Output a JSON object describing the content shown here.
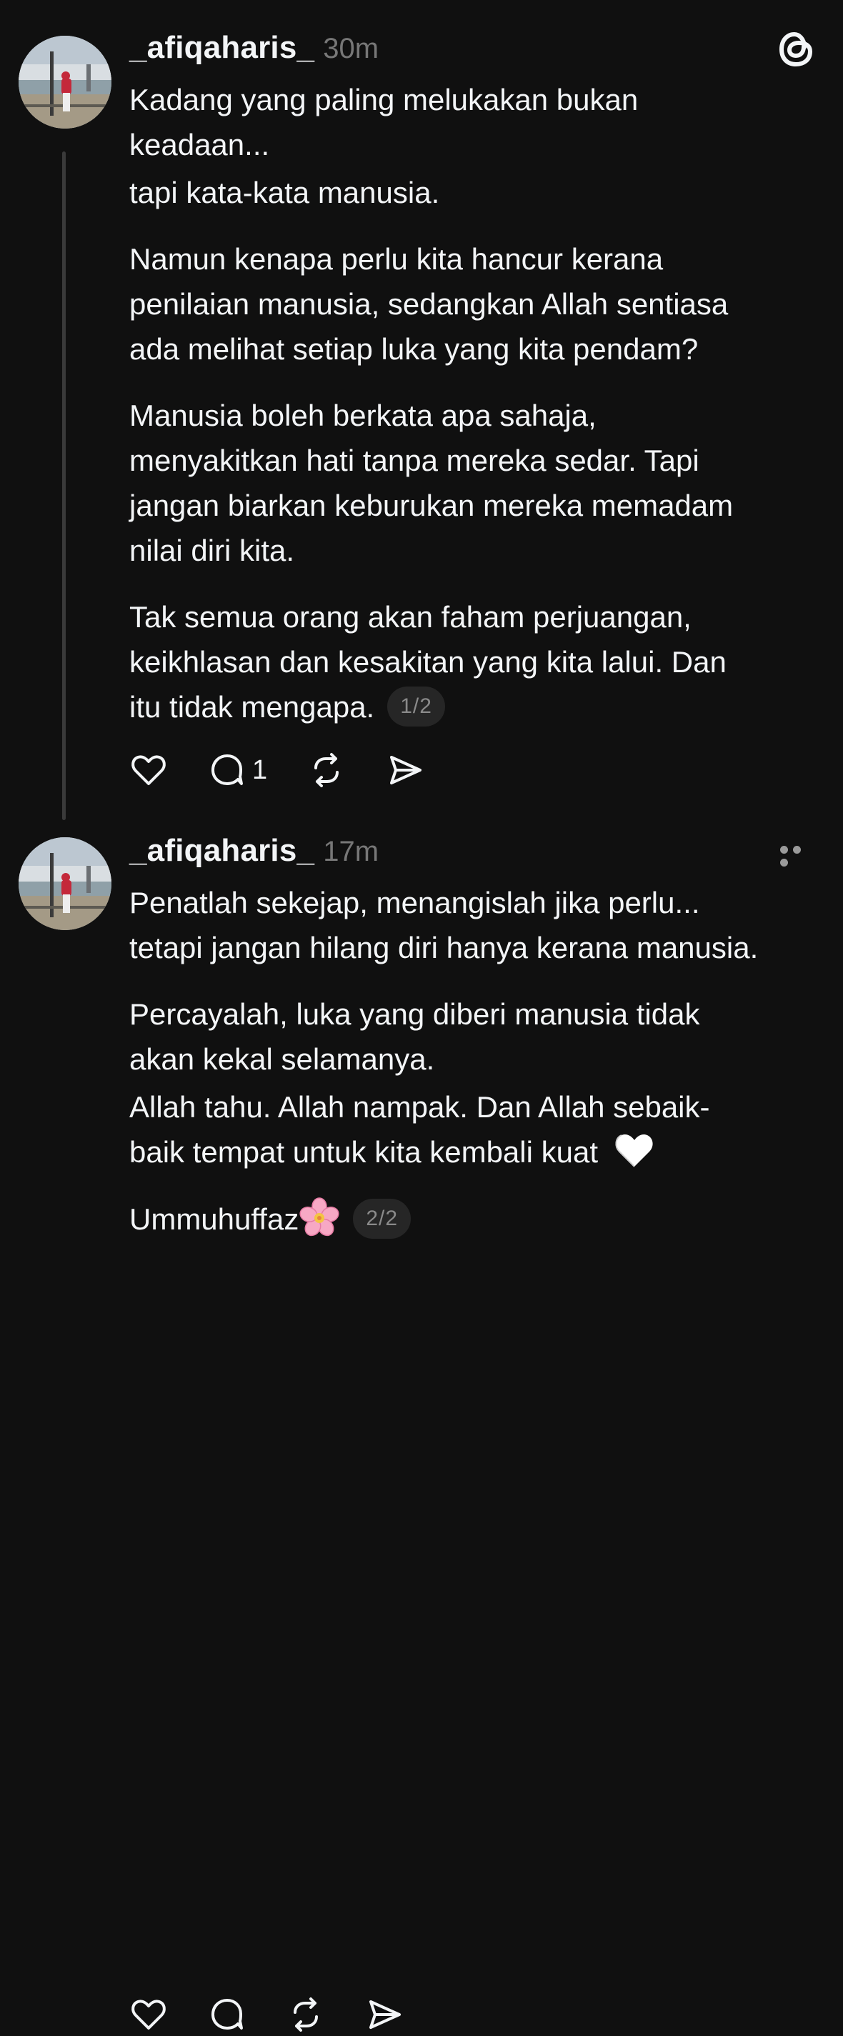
{
  "posts": [
    {
      "username": "_afiqaharis_",
      "time": "30m",
      "paragraphs": [
        [
          "Kadang yang paling melukakan bukan",
          "keadaan..."
        ],
        [
          "tapi kata-kata manusia."
        ],
        [
          "Namun kenapa perlu kita hancur kerana",
          "penilaian manusia, sedangkan Allah sentiasa",
          "ada melihat setiap luka yang kita pendam?"
        ],
        [
          "Manusia boleh berkata apa sahaja,",
          "menyakitkan hati tanpa mereka sedar. Tapi",
          "jangan biarkan keburukan mereka memadam",
          "nilai diri kita."
        ],
        [
          "Tak semua orang akan faham perjuangan,",
          "keikhlasan dan kesakitan yang kita lalui. Dan",
          "itu tidak mengapa."
        ]
      ],
      "page_badge": "1/2",
      "reply_count": "1"
    },
    {
      "username": "_afiqaharis_",
      "time": "17m",
      "paragraphs": [
        [
          "Penatlah sekejap, menangislah jika perlu...",
          "tetapi jangan hilang diri hanya kerana manusia."
        ],
        [
          "Percayalah, luka yang diberi manusia tidak",
          "akan kekal selamanya."
        ],
        [
          "Allah tahu. Allah nampak. Dan Allah sebaik-",
          "baik tempat untuk kita kembali kuat"
        ],
        [
          "Ummuhuffaz"
        ]
      ],
      "page_badge": "2/2"
    }
  ],
  "icons": {
    "logo": "threads-logo-icon",
    "more": "more-options-icon",
    "like": "heart-icon",
    "reply": "comment-icon",
    "repost": "repost-icon",
    "share": "send-icon",
    "emoji_heart": "white-heart-emoji",
    "emoji_flower": "cherry-blossom-emoji"
  },
  "colors": {
    "background": "#101010",
    "text": "#f3f5f7",
    "muted": "#777777",
    "badge_bg": "#262626",
    "thread_line": "#3a3a3a"
  }
}
